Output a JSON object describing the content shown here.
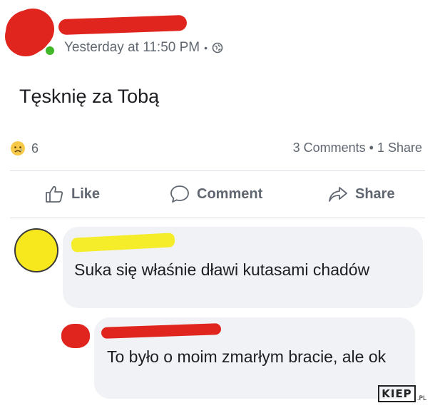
{
  "post": {
    "timestamp": "Yesterday at 11:50 PM",
    "separator": "•",
    "text": "Tęsknię za Tobą",
    "reaction_count": "6",
    "stats": "3 Comments • 1 Share"
  },
  "actions": {
    "like": "Like",
    "comment": "Comment",
    "share": "Share"
  },
  "comments": [
    {
      "text": "Suka się właśnie dławi kutasami chadów"
    },
    {
      "text": "To było o moim zmarłym bracie, ale ok"
    }
  ],
  "watermark": {
    "main": "KIEP",
    "suffix": ".PL"
  },
  "colors": {
    "redaction_red": "#e0251f",
    "redaction_yellow": "#f5ec2a",
    "bubble_bg": "#f0f2f5",
    "secondary_text": "#606770",
    "online_green": "#42b72a"
  },
  "icons": {
    "privacy": "globe-icon",
    "reaction": "sad-face-icon",
    "like": "thumbs-up-icon",
    "comment": "speech-bubble-icon",
    "share": "share-arrow-icon"
  }
}
